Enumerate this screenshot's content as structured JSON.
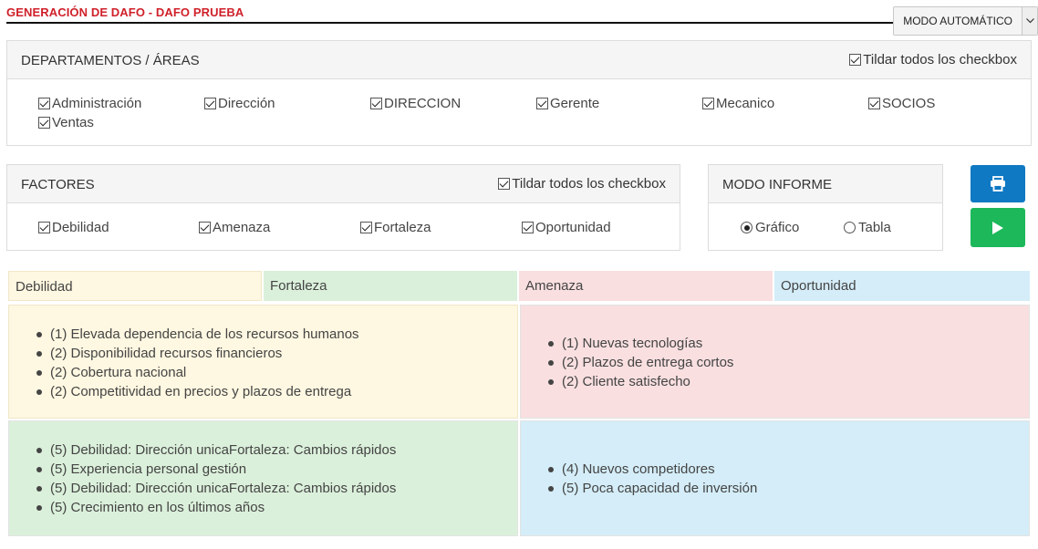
{
  "header": {
    "title": "GENERACIÓN DE DAFO - DAFO PRUEBA",
    "mode_select": "MODO AUTOMÁTICO"
  },
  "departments": {
    "title": "DEPARTAMENTOS / ÁREAS",
    "check_all": "Tildar todos los checkbox",
    "items": [
      "Administración",
      "Dirección",
      "DIRECCION",
      "Gerente",
      "Mecanico",
      "SOCIOS",
      "Ventas"
    ]
  },
  "factors": {
    "title": "FACTORES",
    "check_all": "Tildar todos los checkbox",
    "items": [
      "Debilidad",
      "Amenaza",
      "Fortaleza",
      "Oportunidad"
    ]
  },
  "report_mode": {
    "title": "MODO INFORME",
    "options": [
      "Gráfico",
      "Tabla"
    ],
    "selected": "Gráfico"
  },
  "actions": {
    "print_icon": "printer-icon",
    "run_icon": "play-icon"
  },
  "matrix": {
    "headers": [
      "Debilidad",
      "Fortaleza",
      "Amenaza",
      "Oportunidad"
    ],
    "header_colors": [
      "#fef7e1",
      "#dbf0db",
      "#f9dfe0",
      "#d4edf8"
    ],
    "debilidad": [
      "(1) Elevada dependencia de los recursos humanos",
      "(2) Disponibilidad recursos financieros",
      "(2) Cobertura nacional",
      "(2) Competitividad en precios y plazos de entrega"
    ],
    "amenaza": [
      "(1) Nuevas tecnologías",
      "(2) Plazos de entrega cortos",
      "(2) Cliente satisfecho"
    ],
    "fortaleza": [
      "(5) Debilidad: Dirección unicaFortaleza: Cambios rápidos",
      "(5) Experiencia personal gestión",
      "(5) Debilidad: Dirección unicaFortaleza: Cambios rápidos",
      "(5) Crecimiento en los últimos años"
    ],
    "oportunidad": [
      "(4) Nuevos competidores",
      "(5) Poca capacidad de inversión"
    ]
  }
}
